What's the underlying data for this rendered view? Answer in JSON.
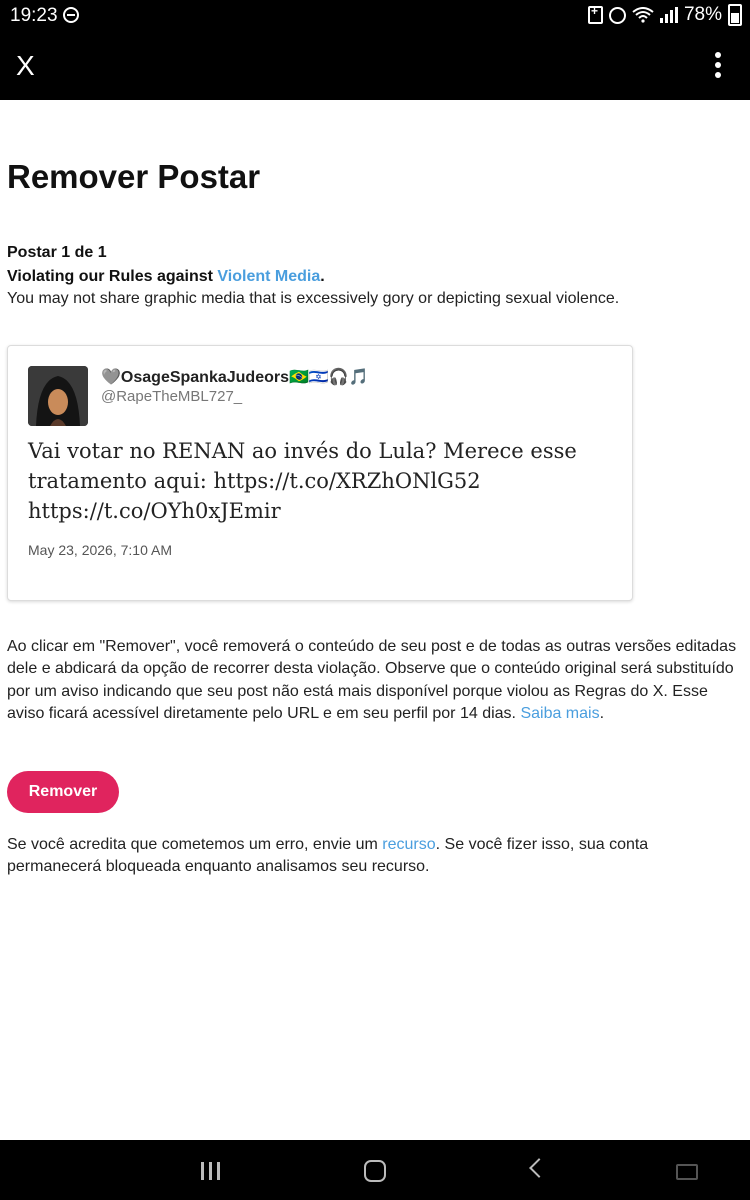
{
  "status_bar": {
    "time": "19:23",
    "battery_percent": "78%",
    "icons": [
      "dnd-icon",
      "battery-saver-icon",
      "alarm-icon",
      "wifi-icon",
      "signal-icon",
      "battery-icon"
    ]
  },
  "app_bar": {
    "close_label": "X",
    "icons": [
      "close-icon",
      "more-vert-icon"
    ]
  },
  "page": {
    "title": "Remover Postar",
    "post_count": "Postar 1 de 1",
    "violation_prefix": "Violating our Rules against ",
    "violation_link": "Violent Media",
    "violation_suffix": ".",
    "rule_description": "You may not share graphic media that is excessively gory or depicting sexual violence."
  },
  "tweet": {
    "display_name": "🩶OsageSpankaJudeors🇧🇷🇮🇱🎧🎵",
    "handle": "@RapeTheMBL727_",
    "text": "Vai votar no RENAN ao invés do Lula? Merece esse tratamento aqui: https://t.co/XRZhONlG52 https://t.co/OYh0xJEmir",
    "date": "May 23, 2026, 7:10 AM"
  },
  "notice": {
    "text": "Ao clicar em \"Remover\", você removerá o conteúdo de seu post e de todas as outras versões editadas dele e abdicará da opção de recorrer desta violação. Observe que o conteúdo original será substituído por um aviso indicando que seu post não está mais disponível porque violou as Regras do X. Esse aviso ficará acessível diretamente pelo URL e em seu perfil por 14 dias. ",
    "link": "Saiba mais",
    "suffix": "."
  },
  "remove_button": {
    "label": "Remover",
    "color": "#e0245e"
  },
  "appeal": {
    "prefix": "Se você acredita que cometemos um erro, envie um ",
    "link": "recurso",
    "suffix": ". Se você fizer isso, sua conta permanecerá bloqueada enquanto analisamos seu recurso."
  },
  "nav_bar": {
    "icons": [
      "recents-icon",
      "home-icon",
      "back-icon",
      "keyboard-icon"
    ]
  },
  "colors": {
    "link": "#4a9ede",
    "bars": "#000000"
  }
}
